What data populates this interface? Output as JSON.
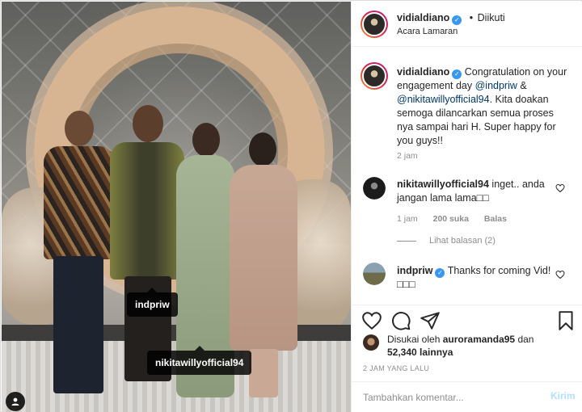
{
  "photo": {
    "tags": [
      {
        "username": "indpriw"
      },
      {
        "username": "nikitawillyofficial94"
      }
    ]
  },
  "header": {
    "username": "vidialdiano",
    "bullet": "•",
    "follow_status": "Diikuti",
    "location": "Acara Lamaran"
  },
  "caption": {
    "username": "vidialdiano",
    "text_before": "Congratulation on your engagement day ",
    "mention1": "@indpriw",
    "amp": " & ",
    "mention2": "@nikitawillyofficial94",
    "text_after": ". Kita doakan semoga dilancarkan semua proses nya sampai hari H. Super happy for you guys!!",
    "time": "2 jam"
  },
  "comments": [
    {
      "username": "nikitawillyofficial94",
      "text": "inget.. anda jangan lama lama",
      "emoji": "□□",
      "time": "1 jam",
      "likes": "200 suka",
      "reply": "Balas",
      "view_replies": "Lihat balasan (2)"
    },
    {
      "username": "indpriw",
      "text": "Thanks for coming Vid!",
      "emoji": "□□□"
    }
  ],
  "likes": {
    "prefix": "Disukai oleh",
    "user": "auroramanda95",
    "and": "dan",
    "count": "52,340 lainnya"
  },
  "timestamp": "2 JAM YANG LALU",
  "comment_box": {
    "placeholder": "Tambahkan komentar...",
    "post_label": "Kirim"
  },
  "colors": {
    "verified": "#3897f0",
    "link": "#00376b",
    "muted": "#8e8e8e",
    "post_disabled": "#b2dffc"
  },
  "icons": [
    "heart-icon",
    "comment-icon",
    "share-icon",
    "bookmark-icon",
    "verified-icon",
    "user-tag-icon"
  ]
}
